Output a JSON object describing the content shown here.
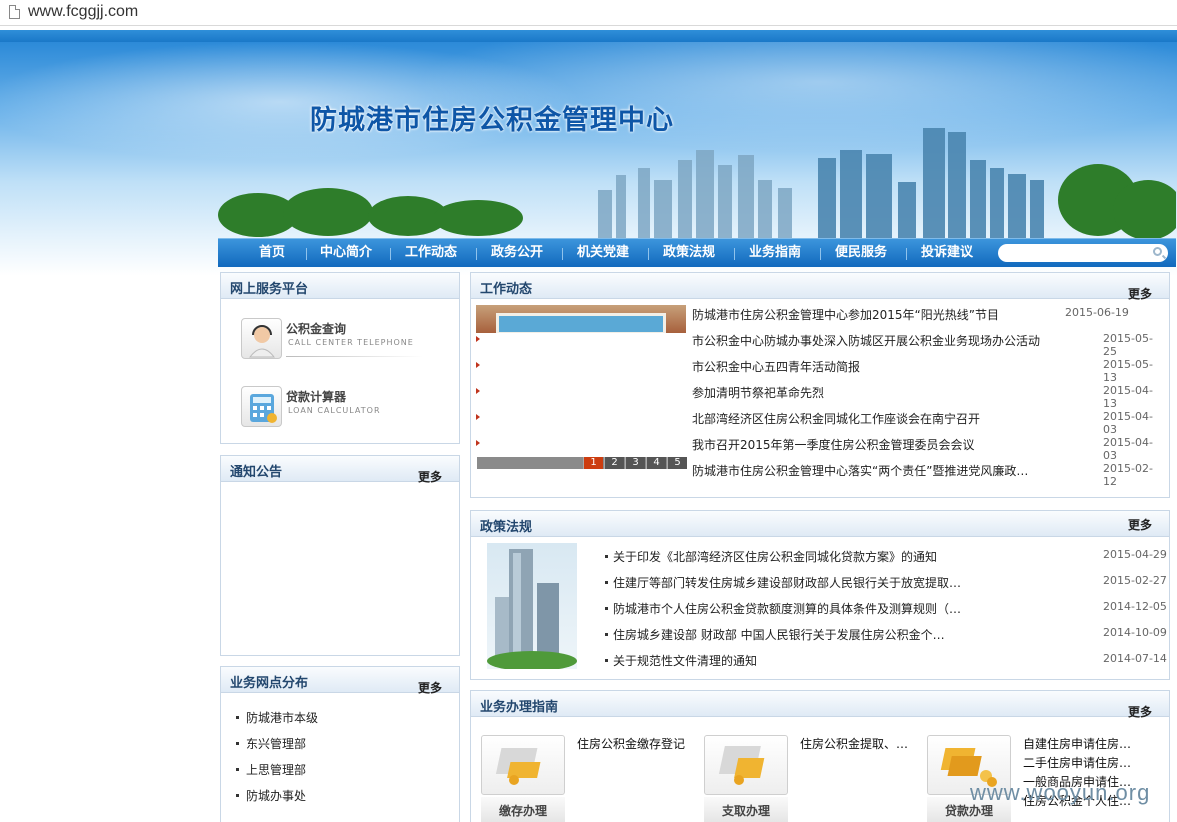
{
  "browser": {
    "url": "www.fcggjj.com"
  },
  "site": {
    "title": "防城港市住房公积金管理中心"
  },
  "nav": {
    "items": [
      "首页",
      "中心简介",
      "工作动态",
      "政务公开",
      "机关党建",
      "政策法规",
      "业务指南",
      "便民服务",
      "投诉建议"
    ],
    "search_placeholder": ""
  },
  "online_services": {
    "title": "网上服务平台",
    "items": [
      {
        "label": "公积金查询",
        "sub": "CALL CENTER TELEPHONE",
        "icon": "headset-icon"
      },
      {
        "label": "贷款计算器",
        "sub": "LOAN CALCULATOR",
        "icon": "calculator-icon"
      }
    ]
  },
  "notice": {
    "title": "通知公告",
    "more": "更多"
  },
  "branches": {
    "title": "业务网点分布",
    "more": "更多",
    "items": [
      "防城港市本级",
      "东兴管理部",
      "上思管理部",
      "防城办事处"
    ]
  },
  "news": {
    "title": "工作动态",
    "more": "更多",
    "items": [
      {
        "text": "防城港市住房公积金管理中心参加2015年“阳光热线”节目",
        "date": "2015-06-19"
      },
      {
        "text": "市公积金中心防城办事处深入防城区开展公积金业务现场办公活动",
        "date": "2015-05-25"
      },
      {
        "text": "市公积金中心五四青年活动简报",
        "date": "2015-05-13"
      },
      {
        "text": "参加清明节祭祀革命先烈",
        "date": "2015-04-13"
      },
      {
        "text": "北部湾经济区住房公积金同城化工作座谈会在南宁召开",
        "date": "2015-04-03"
      },
      {
        "text": "我市召开2015年第一季度住房公积金管理委员会会议",
        "date": "2015-04-03"
      },
      {
        "text": "防城港市住房公积金管理中心落实“两个责任”暨推进党风廉政…",
        "date": "2015-02-12"
      }
    ],
    "pager": [
      "1",
      "2",
      "3",
      "4",
      "5"
    ],
    "pager_active": 1
  },
  "policy": {
    "title": "政策法规",
    "more": "更多",
    "items": [
      {
        "text": "关于印发《北部湾经济区住房公积金同城化贷款方案》的通知",
        "date": "2015-04-29"
      },
      {
        "text": "住建厅等部门转发住房城乡建设部财政部人民银行关于放宽提取…",
        "date": "2015-02-27"
      },
      {
        "text": "防城港市个人住房公积金贷款额度测算的具体条件及测算规则（…",
        "date": "2014-12-05"
      },
      {
        "text": "住房城乡建设部 财政部 中国人民银行关于发展住房公积金个…",
        "date": "2014-10-09"
      },
      {
        "text": "关于规范性文件清理的通知",
        "date": "2014-07-14"
      }
    ]
  },
  "guide": {
    "title": "业务办理指南",
    "more": "更多",
    "items": [
      {
        "caption": "缴存办理",
        "lines": [
          "住房公积金缴存登记"
        ]
      },
      {
        "caption": "支取办理",
        "lines": [
          "住房公积金提取、…"
        ]
      },
      {
        "caption": "贷款办理",
        "lines": [
          "自建住房申请住房…",
          "二手住房申请住房…",
          "一般商品房申请住…",
          "住房公积金个人住…"
        ]
      }
    ]
  },
  "watermark": "www.wooyun.org",
  "colors": {
    "nav": "#1a74c4",
    "title": "#0e56a7",
    "arrow": "#c0341d",
    "pager_active": "#cc3d10"
  }
}
